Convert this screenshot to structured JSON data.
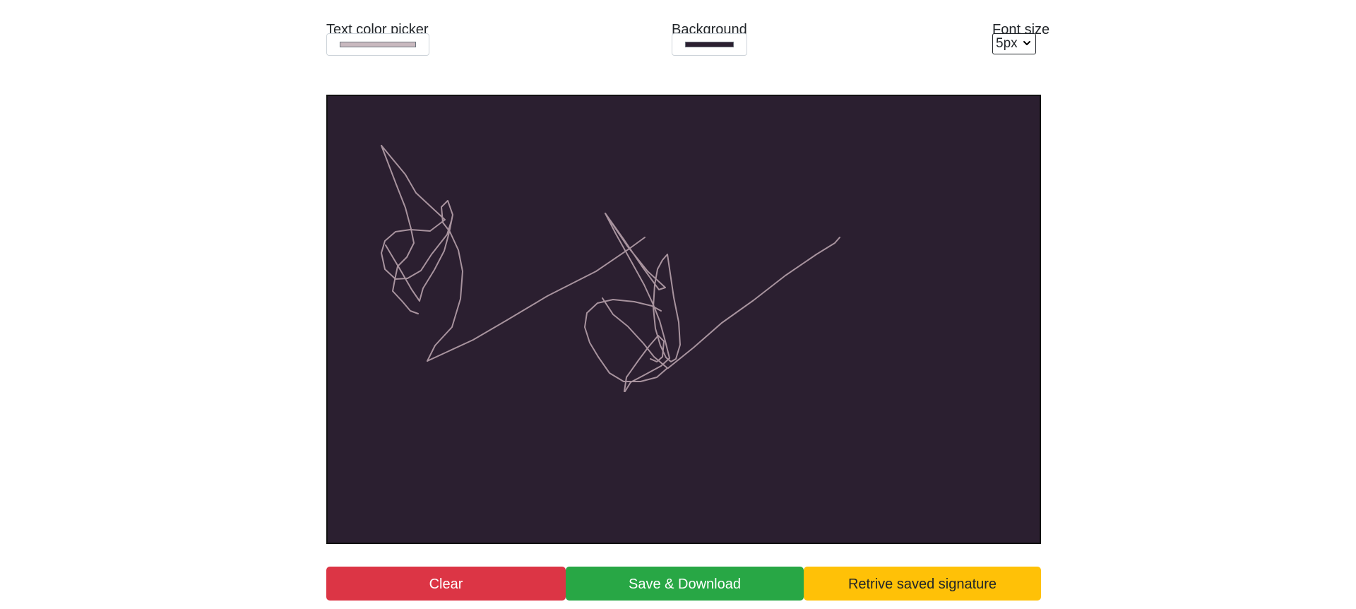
{
  "controls": {
    "text_color": {
      "label": "Text color picker",
      "value": "#c9b9bf"
    },
    "background": {
      "label": "Background",
      "value": "#2b1f30"
    },
    "font_size": {
      "label": "Font size",
      "value": "5px"
    }
  },
  "canvas": {
    "background_color": "#2b1f30",
    "stroke_color": "#a8939e"
  },
  "buttons": {
    "clear": "Clear",
    "save": "Save & Download",
    "retrieve": "Retrive saved signature"
  },
  "colors": {
    "clear": "#dc3545",
    "save": "#28a745",
    "retrieve": "#ffc107"
  },
  "icons": {
    "font_size_dropdown": "chevron-down-icon"
  }
}
